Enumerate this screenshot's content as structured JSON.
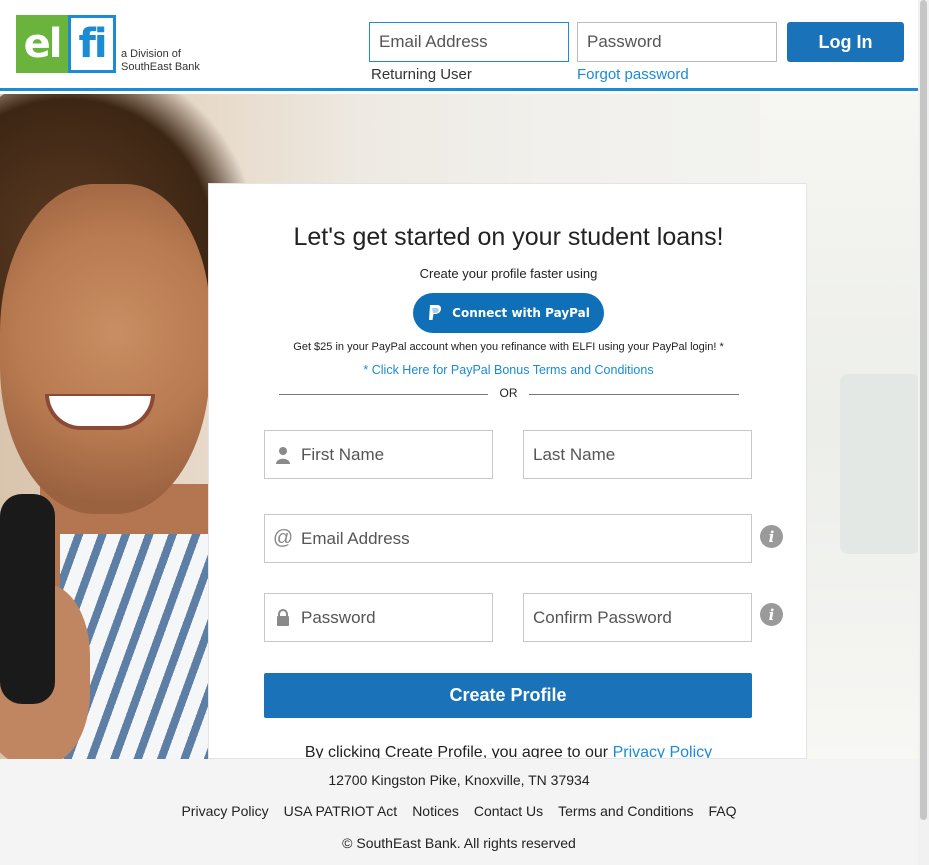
{
  "header": {
    "logo_left": "el",
    "logo_right": "fi",
    "logo_sub_line1": "a Division of",
    "logo_sub_line2": "SouthEast Bank",
    "email_placeholder": "Email Address",
    "password_placeholder": "Password",
    "login_label": "Log In",
    "returning_label": "Returning User",
    "forgot_label": "Forgot password"
  },
  "card": {
    "title": "Let's get started on your student loans!",
    "subtitle": "Create your profile faster using",
    "paypal_label": "Connect with PayPal",
    "bonus_text": "Get $25 in your PayPal account when you refinance with ELFI using your PayPal login! *",
    "bonus_link": "* Click Here for PayPal Bonus Terms and Conditions",
    "or_label": "OR",
    "fields": {
      "first_name": "First Name",
      "last_name": "Last Name",
      "email": "Email Address",
      "password": "Password",
      "confirm_password": "Confirm Password"
    },
    "info_glyph": "i",
    "create_label": "Create Profile",
    "agree_text": "By clicking Create Profile, you agree to our ",
    "agree_link": "Privacy Policy"
  },
  "footer": {
    "address": "12700 Kingston Pike, Knoxville, TN 37934",
    "links": [
      "Privacy Policy",
      "USA PATRIOT Act",
      "Notices",
      "Contact Us",
      "Terms and Conditions",
      "FAQ"
    ],
    "copyright": "© SouthEast Bank. All rights reserved"
  },
  "colors": {
    "brand_blue": "#1a73b8",
    "link_blue": "#1a8bd4",
    "logo_green": "#6ab43e"
  }
}
